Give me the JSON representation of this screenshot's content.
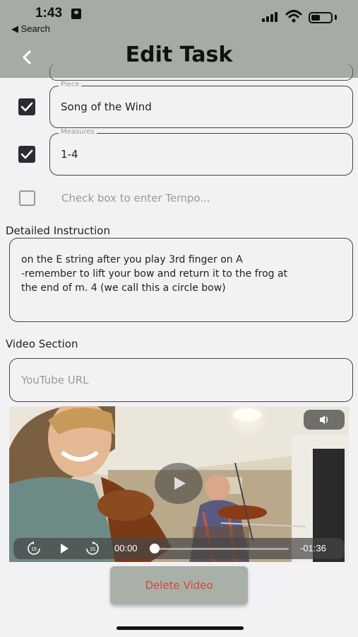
{
  "status_bar": {
    "time": "1:43",
    "back_app": "◀ Search"
  },
  "header": {
    "title": "Edit Task",
    "background": "#a4aca4"
  },
  "fields": {
    "piece": {
      "label": "Piece",
      "value": "Song of the Wind",
      "checked": true
    },
    "measures": {
      "label": "Measures",
      "value": "1-4",
      "checked": true
    },
    "tempo": {
      "placeholder": "Check box to enter Tempo...",
      "checked": false
    }
  },
  "detailed_instruction": {
    "label": "Detailed Instruction",
    "text": "on the E string after you play 3rd finger on A\n-remember to lift your bow and return it to the frog at\nthe end of m. 4 (we call this a circle bow)"
  },
  "video_section": {
    "label": "Video Section",
    "url_placeholder": "YouTube URL",
    "player": {
      "elapsed": "00:00",
      "remaining": "-01:36",
      "skip_back_seconds": "15",
      "skip_forward_seconds": "15",
      "progress": 0.0
    }
  },
  "delete_button": {
    "label": "Delete Video",
    "color": "#d9443c"
  }
}
